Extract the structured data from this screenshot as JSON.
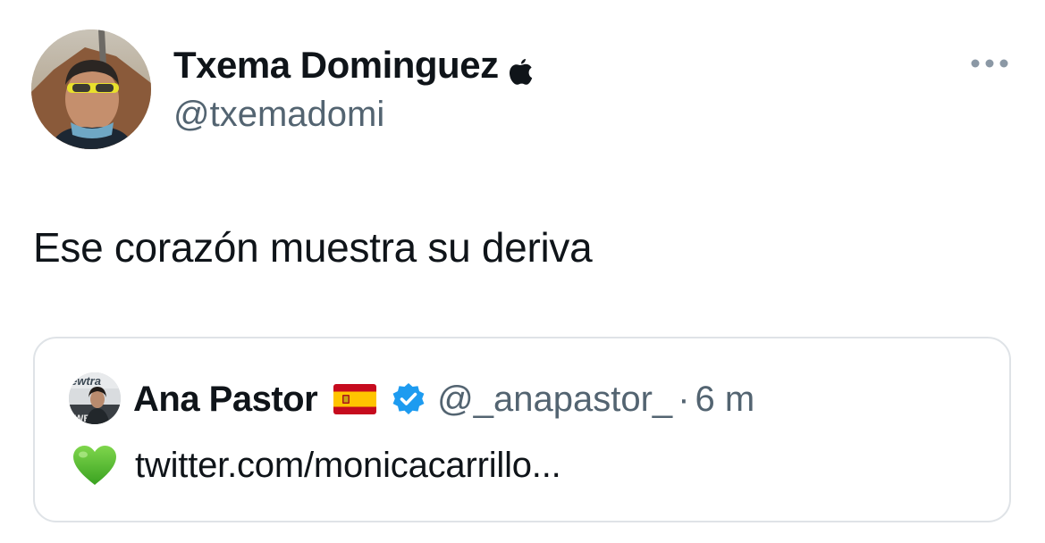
{
  "author": {
    "display_name": "Txema Dominguez",
    "handle": "@txemadomi",
    "badge_icon": "apple-icon",
    "avatar_icon": "profile-photo"
  },
  "more_icon": "more-horizontal-icon",
  "tweet": {
    "text": "Ese corazón muestra su deriva"
  },
  "quoted": {
    "display_name": "Ana Pastor",
    "flag_icon": "spain-flag-icon",
    "verified_icon": "verified-badge-icon",
    "handle": "@_anapastor_",
    "separator": "·",
    "time": "6 m",
    "heart_icon": "green-heart-icon",
    "text": "twitter.com/monicacarrillo...",
    "avatar_logo_text_top": "ewtra",
    "avatar_logo_text_bottom": "WE"
  },
  "colors": {
    "text_primary": "#0f1419",
    "text_secondary": "#536471",
    "border": "#dfe3e7",
    "verified_blue": "#1d9bf0",
    "heart_green": "#5bc236"
  }
}
